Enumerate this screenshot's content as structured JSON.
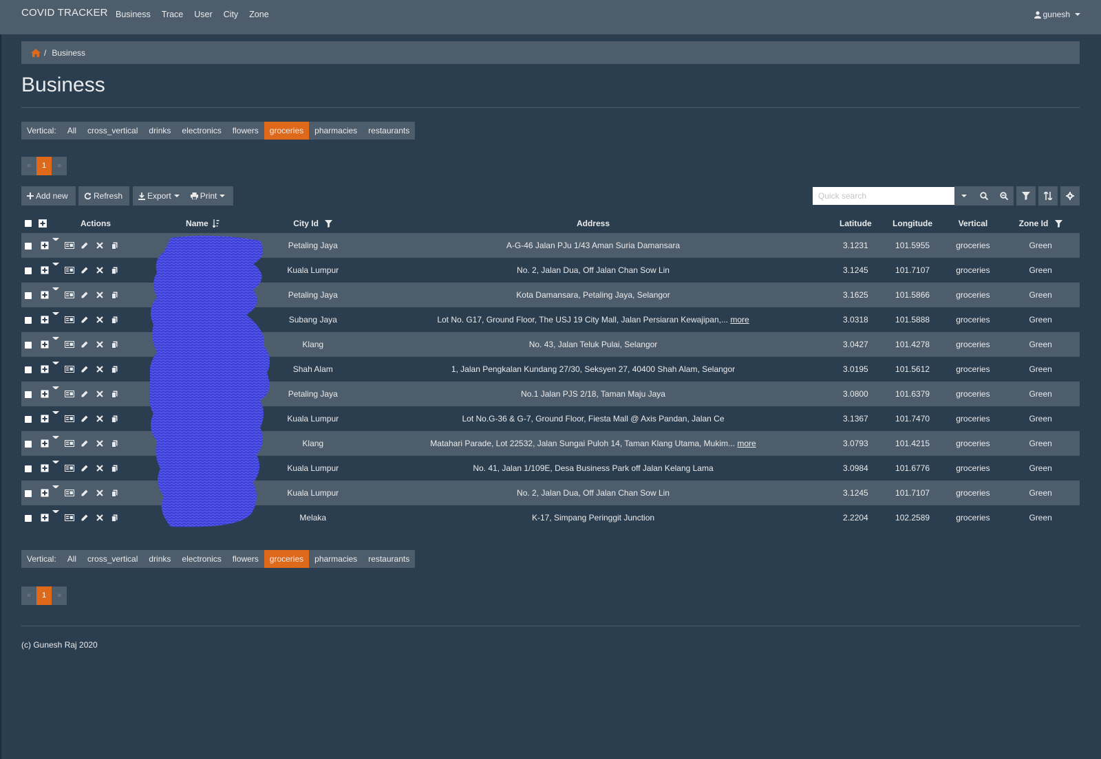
{
  "navbar": {
    "brand": "COVID TRACKER",
    "links": [
      "Business",
      "Trace",
      "User",
      "City",
      "Zone"
    ],
    "user": "gunesh"
  },
  "breadcrumb": {
    "current": "Business"
  },
  "page_title": "Business",
  "vertical_filter": {
    "label": "Vertical:",
    "options": [
      "All",
      "cross_vertical",
      "drinks",
      "electronics",
      "flowers",
      "groceries",
      "pharmacies",
      "restaurants"
    ],
    "active": "groceries"
  },
  "pager": {
    "prev": "«",
    "current": "1",
    "next": "»"
  },
  "toolbar": {
    "add_new": "Add new",
    "refresh": "Refresh",
    "export": "Export",
    "print": "Print",
    "search_placeholder": "Quick search"
  },
  "table": {
    "headers": {
      "actions": "Actions",
      "name": "Name",
      "city": "City Id",
      "address": "Address",
      "latitude": "Latitude",
      "longitude": "Longitude",
      "vertical": "Vertical",
      "zone": "Zone Id"
    },
    "more_label": "more",
    "rows": [
      {
        "city": "Petaling Jaya",
        "address": "A-G-46 Jalan PJu 1/43 Aman Suria Damansara",
        "more": false,
        "lat": "3.1231",
        "lng": "101.5955",
        "vertical": "groceries",
        "zone": "Green"
      },
      {
        "city": "Kuala Lumpur",
        "address": "No. 2, Jalan Dua, Off Jalan Chan Sow Lin",
        "more": false,
        "lat": "3.1245",
        "lng": "101.7107",
        "vertical": "groceries",
        "zone": "Green"
      },
      {
        "city": "Petaling Jaya",
        "address": "Kota Damansara, Petaling Jaya, Selangor",
        "more": false,
        "lat": "3.1625",
        "lng": "101.5866",
        "vertical": "groceries",
        "zone": "Green"
      },
      {
        "city": "Subang Jaya",
        "address": "Lot No. G17, Ground Floor, The USJ 19 City Mall, Jalan Persiaran Kewajipan,...",
        "more": true,
        "lat": "3.0318",
        "lng": "101.5888",
        "vertical": "groceries",
        "zone": "Green"
      },
      {
        "city": "Klang",
        "address": "No. 43, Jalan Teluk Pulai, Selangor",
        "more": false,
        "lat": "3.0427",
        "lng": "101.4278",
        "vertical": "groceries",
        "zone": "Green"
      },
      {
        "city": "Shah Alam",
        "address": "1, Jalan Pengkalan Kundang 27/30, Seksyen 27, 40400 Shah Alam, Selangor",
        "more": false,
        "lat": "3.0195",
        "lng": "101.5612",
        "vertical": "groceries",
        "zone": "Green"
      },
      {
        "city": "Petaling Jaya",
        "address": "No.1 Jalan PJS 2/18, Taman Maju Jaya",
        "more": false,
        "lat": "3.0800",
        "lng": "101.6379",
        "vertical": "groceries",
        "zone": "Green"
      },
      {
        "city": "Kuala Lumpur",
        "address": "Lot No.G-36 & G-7, Ground Floor, Fiesta Mall @ Axis Pandan, Jalan Ce",
        "more": false,
        "lat": "3.1367",
        "lng": "101.7470",
        "vertical": "groceries",
        "zone": "Green"
      },
      {
        "city": "Klang",
        "address": "Matahari Parade, Lot 22532, Jalan Sungai Puloh 14, Taman Klang Utama, Mukim...",
        "more": true,
        "lat": "3.0793",
        "lng": "101.4215",
        "vertical": "groceries",
        "zone": "Green"
      },
      {
        "city": "Kuala Lumpur",
        "address": "No. 41, Jalan 1/109E, Desa Business Park off Jalan Kelang Lama",
        "more": false,
        "lat": "3.0984",
        "lng": "101.6776",
        "vertical": "groceries",
        "zone": "Green"
      },
      {
        "city": "Kuala Lumpur",
        "address": "No. 2, Jalan Dua, Off Jalan Chan Sow Lin",
        "more": false,
        "lat": "3.1245",
        "lng": "101.7107",
        "vertical": "groceries",
        "zone": "Green"
      },
      {
        "city": "Melaka",
        "address": "K-17, Simpang Peringgit Junction",
        "more": false,
        "lat": "2.2204",
        "lng": "102.2589",
        "vertical": "groceries",
        "zone": "Green"
      }
    ]
  },
  "footer": "(c) Gunesh Raj 2020",
  "colors": {
    "background": "#2b3e50",
    "panel": "#4e5d6c",
    "accent": "#df691a",
    "text": "#ebebeb",
    "redaction": "#3b3fd8"
  }
}
